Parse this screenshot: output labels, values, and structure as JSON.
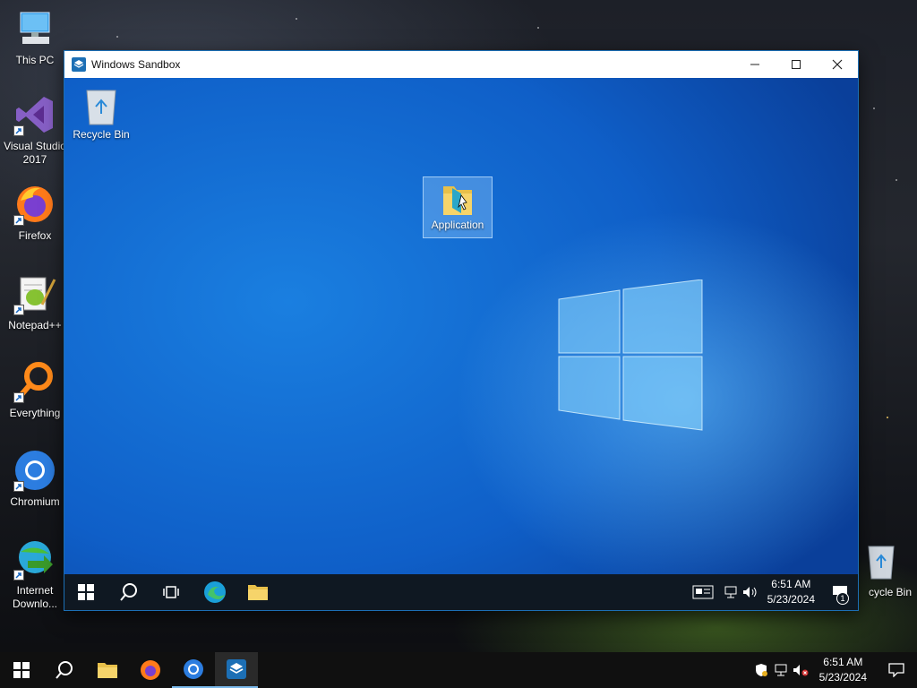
{
  "host_desktop": {
    "icons": [
      {
        "label": "This PC",
        "icon": "this-pc-icon"
      },
      {
        "label": "Visual Studio 2017",
        "icon": "visual-studio-icon"
      },
      {
        "label": "Firefox",
        "icon": "firefox-icon"
      },
      {
        "label": "Notepad++",
        "icon": "notepad-plus-plus-icon"
      },
      {
        "label": "Everything",
        "icon": "everything-icon"
      },
      {
        "label": "Chromium",
        "icon": "chromium-icon"
      },
      {
        "label": "Internet Downlo...",
        "icon": "internet-download-manager-icon"
      },
      {
        "label": "cycle Bin",
        "icon": "recycle-bin-icon"
      }
    ]
  },
  "sandbox_window": {
    "title": "Windows Sandbox",
    "desktop_icons": [
      {
        "label": "Recycle Bin",
        "icon": "recycle-bin-icon"
      },
      {
        "label": "Application",
        "icon": "folder-icon"
      }
    ],
    "taskbar": {
      "time": "6:51 AM",
      "date": "5/23/2024",
      "notification_count": "1"
    }
  },
  "host_taskbar": {
    "time": "6:51 AM",
    "date": "5/23/2024"
  },
  "colors": {
    "sandbox_accent": "#1c6fb5",
    "windows_blue": "#0f5fc8",
    "taskbar": "#101010"
  }
}
